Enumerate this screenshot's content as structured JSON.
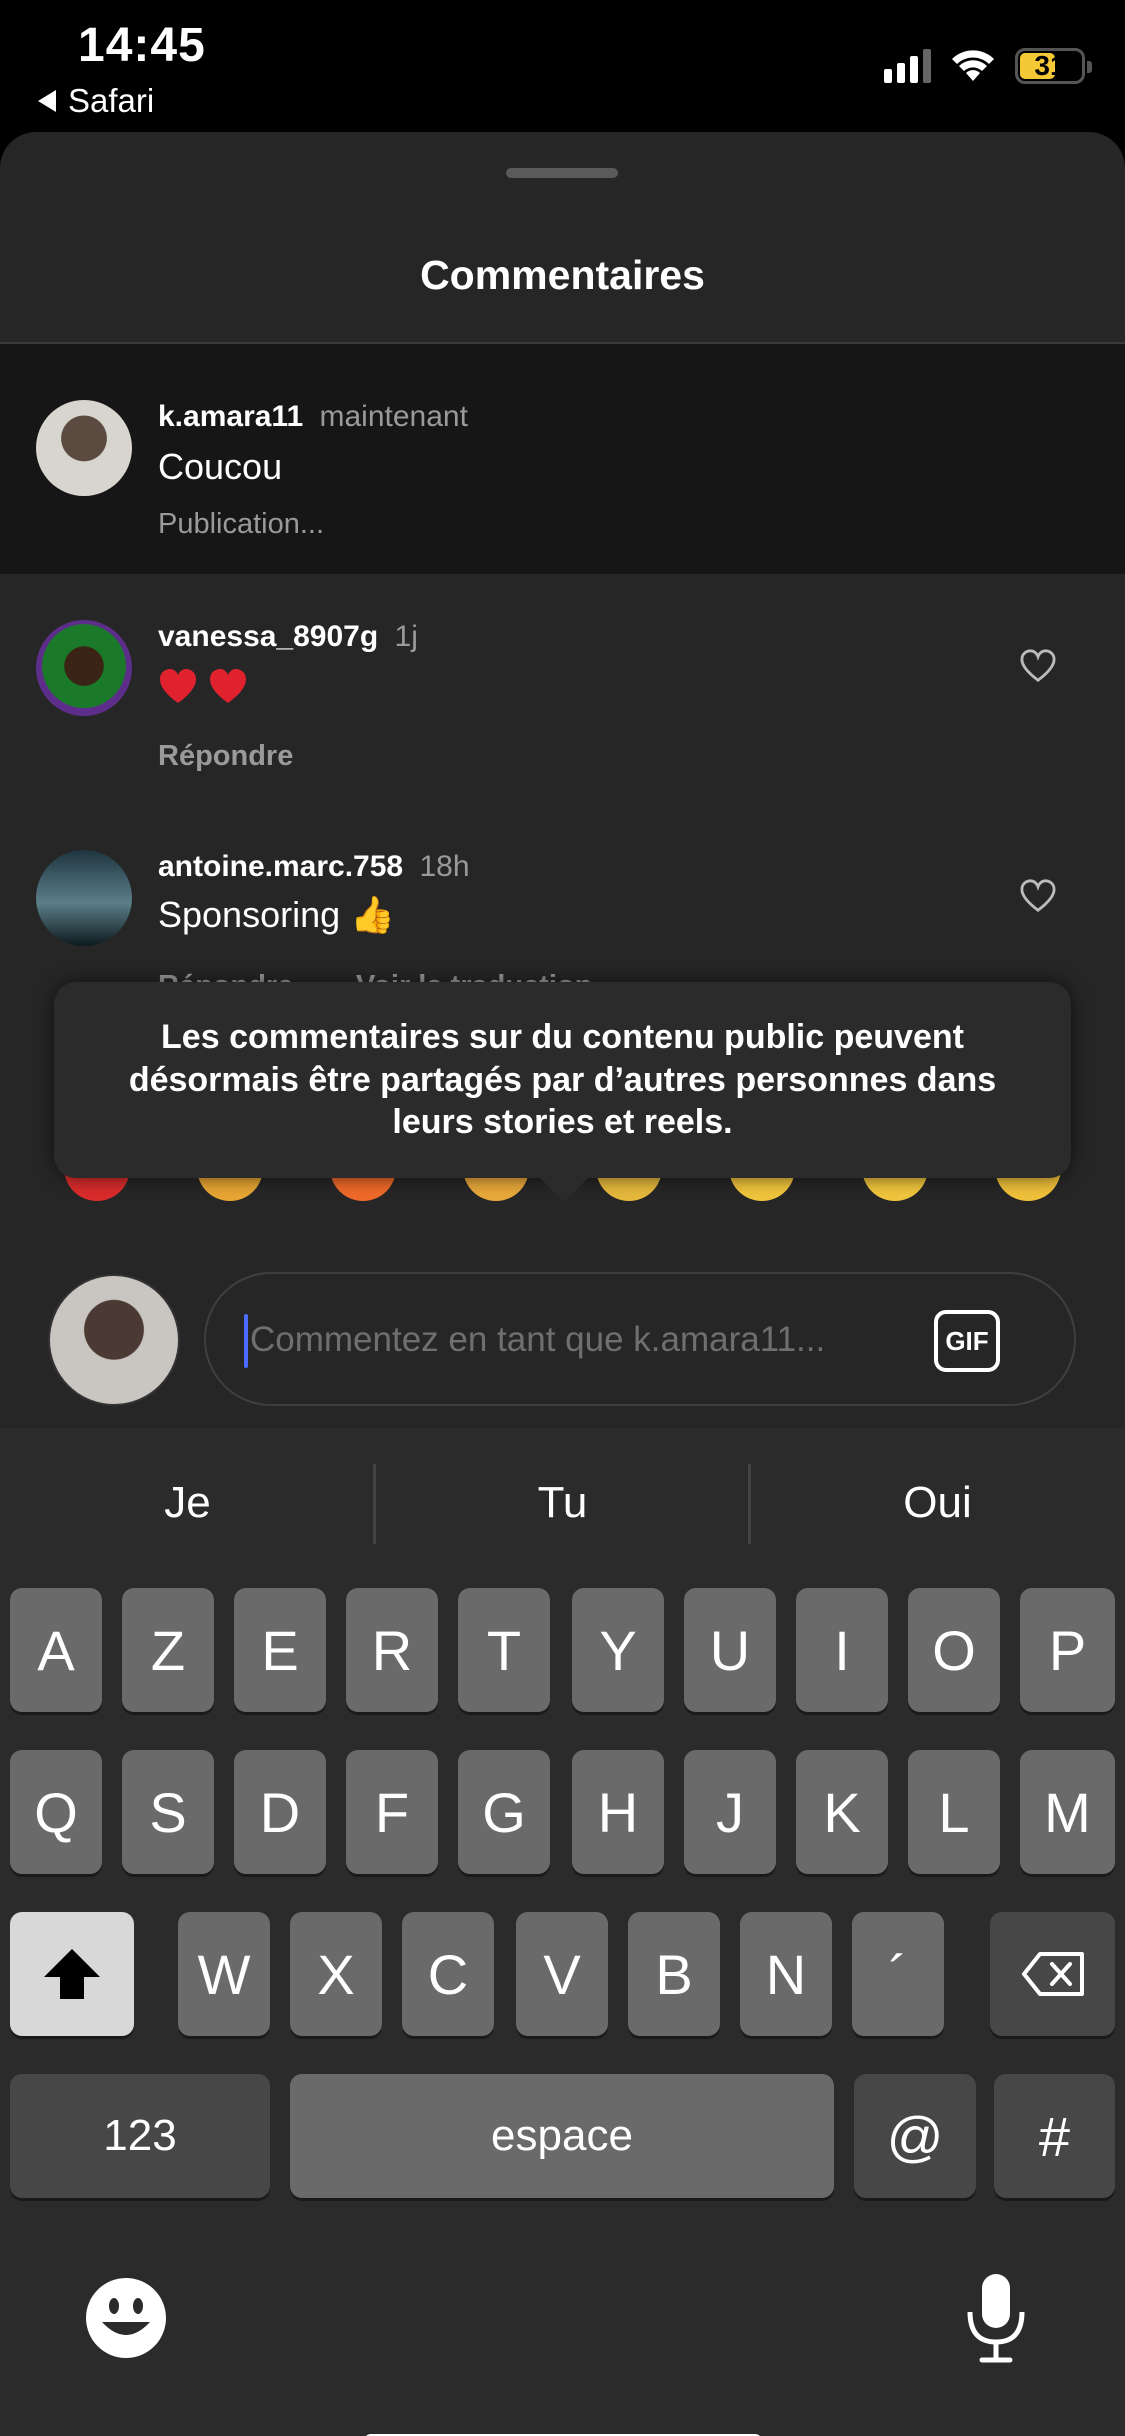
{
  "status_bar": {
    "time": "14:45",
    "back_label": "Safari",
    "battery": "31"
  },
  "sheet": {
    "title": "Commentaires"
  },
  "comments": [
    {
      "user": "k.amara11",
      "time": "maintenant",
      "text": "Coucou",
      "sub": "Publication..."
    },
    {
      "user": "vanessa_8907g",
      "time": "1j",
      "text": "",
      "sub": "Répondre"
    },
    {
      "user": "antoine.marc.758",
      "time": "18h",
      "text": "Sponsoring 👍",
      "sub": "Répondre",
      "sub2": "Voir la traduction"
    }
  ],
  "tooltip": "Les commentaires sur du contenu public peuvent désormais être partagés par d’autres personnes dans leurs stories et reels.",
  "input": {
    "placeholder": "Commentez en tant que k.amara11...",
    "gif_label": "GIF"
  },
  "keyboard": {
    "suggestions": [
      "Je",
      "Tu",
      "Oui"
    ],
    "row1": [
      "A",
      "Z",
      "E",
      "R",
      "T",
      "Y",
      "U",
      "I",
      "O",
      "P"
    ],
    "row2": [
      "Q",
      "S",
      "D",
      "F",
      "G",
      "H",
      "J",
      "K",
      "L",
      "M"
    ],
    "row3": [
      "W",
      "X",
      "C",
      "V",
      "B",
      "N",
      "´"
    ],
    "numbers_label": "123",
    "space_label": "espace",
    "at_label": "@",
    "hash_label": "#"
  },
  "colors": {
    "accent_caret": "#4b6bff",
    "battery": "#f4c935"
  }
}
